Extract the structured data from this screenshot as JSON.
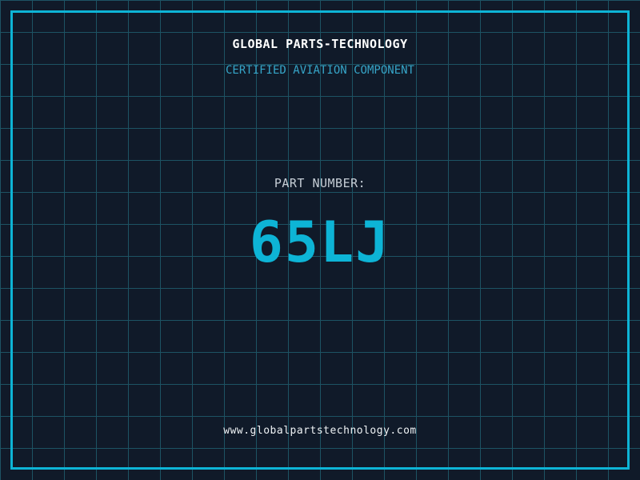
{
  "theme": {
    "background": "#101a29",
    "grid_line": "#1d5364",
    "frame_border": "#0db4d6",
    "accent_cyan": "#0db4d6",
    "title_color": "#ffffff",
    "subtitle_color": "#36a5c8",
    "label_color": "#c6ced6",
    "url_color": "#eef2f4"
  },
  "header": {
    "title": "GLOBAL PARTS-TECHNOLOGY",
    "subtitle": "CERTIFIED AVIATION COMPONENT"
  },
  "part": {
    "label": "PART NUMBER:",
    "number": "65LJ"
  },
  "footer": {
    "url": "www.globalpartstechnology.com"
  }
}
